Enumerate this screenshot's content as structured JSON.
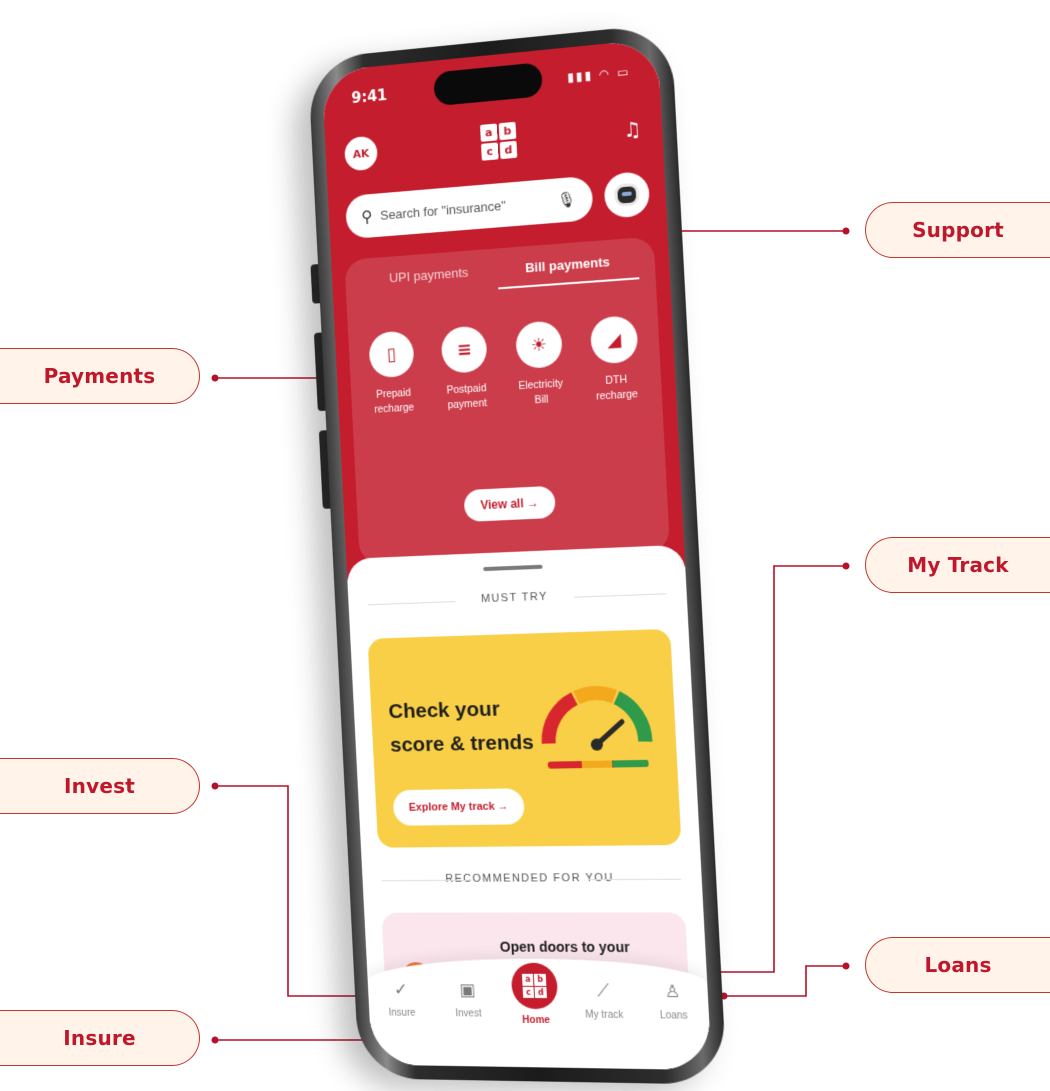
{
  "status_bar": {
    "time": "9:41",
    "icons": "▮▮▮ ◠ ▭"
  },
  "header": {
    "avatar_initials": "AK",
    "logo_letters": [
      "a",
      "b",
      "c",
      "d"
    ],
    "bell_icon": "bell-icon"
  },
  "search": {
    "placeholder": "Search for \"insurance\""
  },
  "payments": {
    "tabs": [
      {
        "label": "UPI payments",
        "active": false
      },
      {
        "label": "Bill payments",
        "active": true
      }
    ],
    "items": [
      {
        "label_line1": "Prepaid",
        "label_line2": "recharge",
        "icon": "phone-icon",
        "glyph": "▯"
      },
      {
        "label_line1": "Postpaid",
        "label_line2": "payment",
        "icon": "bill-icon",
        "glyph": "≡"
      },
      {
        "label_line1": "Electricity",
        "label_line2": "Bill",
        "icon": "bulb-icon",
        "glyph": "☀"
      },
      {
        "label_line1": "DTH",
        "label_line2": "recharge",
        "icon": "dish-icon",
        "glyph": "◢"
      }
    ],
    "view_all": "View all →"
  },
  "must_try": {
    "section_title": "MUST TRY",
    "card_title": "Check your score & trends",
    "cta": "Explore My track →"
  },
  "recommended": {
    "section_title": "RECOMMENDED FOR YOU",
    "card_title": "Open doors to your dream home soon"
  },
  "bottom_nav": [
    {
      "label": "Insure",
      "icon": "shield-check-icon",
      "glyph": "✓"
    },
    {
      "label": "Invest",
      "icon": "invest-icon",
      "glyph": "▣"
    },
    {
      "label": "Home",
      "icon": "home-logo-icon",
      "glyph": ""
    },
    {
      "label": "My track",
      "icon": "chart-icon",
      "glyph": "⟋"
    },
    {
      "label": "Loans",
      "icon": "loans-icon",
      "glyph": "♙"
    }
  ],
  "callouts": {
    "support": "Support",
    "payments": "Payments",
    "my_track": "My Track",
    "invest": "Invest",
    "loans": "Loans",
    "insure": "Insure"
  },
  "colors": {
    "brand_red": "#c41e2e",
    "callout_text": "#c0182b",
    "callout_bg": "#fff3ea",
    "card_yellow": "#f9cf47"
  }
}
